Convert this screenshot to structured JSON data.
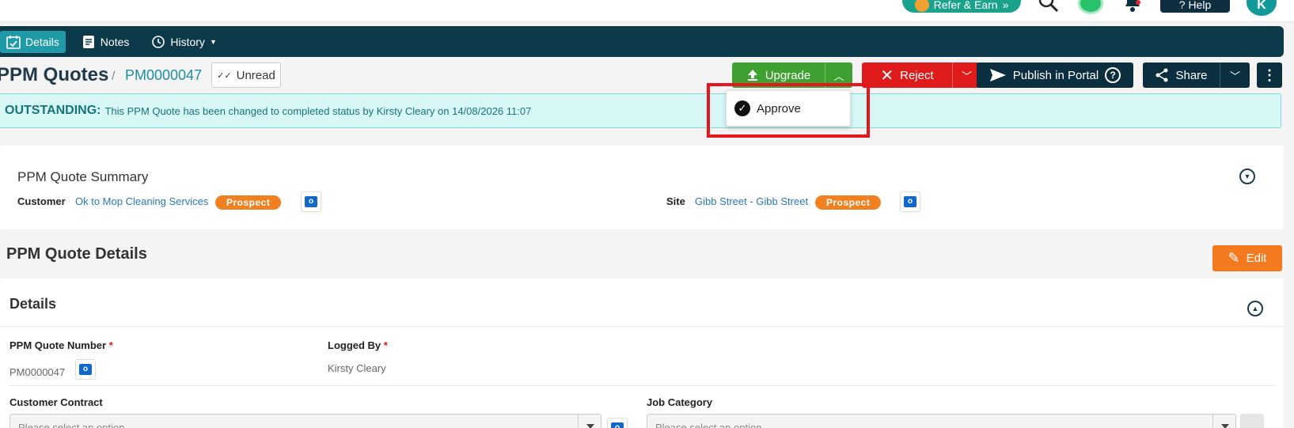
{
  "topbar": {
    "refer_label": "Refer & Earn",
    "help_label": "Help",
    "avatar_initial": "K"
  },
  "tabs": [
    {
      "label": "Details",
      "icon": "calendar-check-icon"
    },
    {
      "label": "Notes",
      "icon": "document-icon"
    },
    {
      "label": "History",
      "icon": "history-icon"
    }
  ],
  "header": {
    "title": "PPM Quotes",
    "separator": "/",
    "quote_number": "PM0000047",
    "unread_label": "Unread"
  },
  "actions": {
    "upgrade_label": "Upgrade",
    "reject_label": "Reject",
    "publish_label": "Publish in Portal",
    "share_label": "Share"
  },
  "dropdown": {
    "approve_label": "Approve"
  },
  "alert": {
    "status": "OUTSTANDING:",
    "message": "This PPM Quote has been changed to completed status by Kirsty Cleary on 14/08/2026 11:07"
  },
  "summary": {
    "title": "PPM Quote Summary",
    "customer_label": "Customer",
    "customer_value": "Ok to Mop Cleaning Services",
    "customer_badge": "Prospect",
    "site_label": "Site",
    "site_value": "Gibb Street - Gibb Street",
    "site_badge": "Prospect"
  },
  "details_section": {
    "title": "PPM Quote Details",
    "edit_label": "Edit",
    "card_title": "Details",
    "quote_number_label": "PPM Quote Number",
    "quote_number_value": "PM0000047",
    "logged_by_label": "Logged By",
    "logged_by_value": "Kirsty Cleary",
    "required_marker": "*",
    "customer_contract_label": "Customer Contract",
    "customer_contract_placeholder": "Please select an option",
    "job_category_label": "Job Category",
    "job_category_placeholder": "Please select an option"
  },
  "colors": {
    "nav_bg": "#0c3a4b",
    "upgrade": "#3fa132",
    "reject": "#e01b1b",
    "dark_button": "#0c2f3f",
    "edit": "#f47a20",
    "badge": "#f08020",
    "highlight": "#e3171d"
  }
}
